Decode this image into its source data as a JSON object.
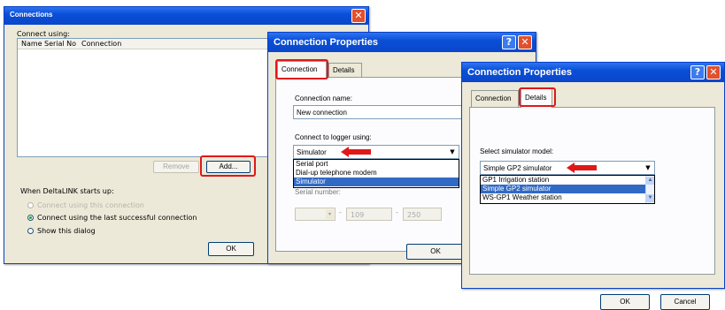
{
  "dialog1": {
    "title": "Connections",
    "connect_using_label": "Connect using:",
    "columns": [
      "Name",
      "Serial No",
      "Connection"
    ],
    "remove_label": "Remove",
    "add_label": "Add...",
    "startup_label": "When DeltaLINK starts up:",
    "radio_options": [
      "Connect using this connection",
      "Connect using the last successful connection",
      "Show this dialog"
    ],
    "ok_label": "OK"
  },
  "dialog2": {
    "title": "Connection Properties",
    "tabs": [
      "Connection",
      "Details"
    ],
    "connection_name_label": "Connection name:",
    "connection_name_value": "New connection",
    "connect_logger_label": "Connect to logger using:",
    "combo_value": "Simulator",
    "options": [
      "Serial port",
      "Dial-up telephone modem",
      "Simulator"
    ],
    "serial_number_label": "Serial number:",
    "serial_fields": [
      "",
      "109",
      "250"
    ],
    "ok_label": "OK"
  },
  "dialog3": {
    "title": "Connection Properties",
    "tabs": [
      "Connection",
      "Details"
    ],
    "select_model_label": "Select simulator model:",
    "combo_value": "Simple GP2 simulator",
    "options": [
      "GP1 Irrigation station",
      "Simple GP2 simulator",
      "WS-GP1 Weather station"
    ],
    "ok_label": "OK",
    "cancel_label": "Cancel"
  },
  "icons": [
    "close-icon",
    "help-icon",
    "dropdown-arrow-icon",
    "red-arrow-icon"
  ],
  "colors": {
    "titlebar": "#0a4fd8",
    "highlight": "#e01818",
    "selection": "#316ac5",
    "dialog_bg": "#ece9d8"
  }
}
